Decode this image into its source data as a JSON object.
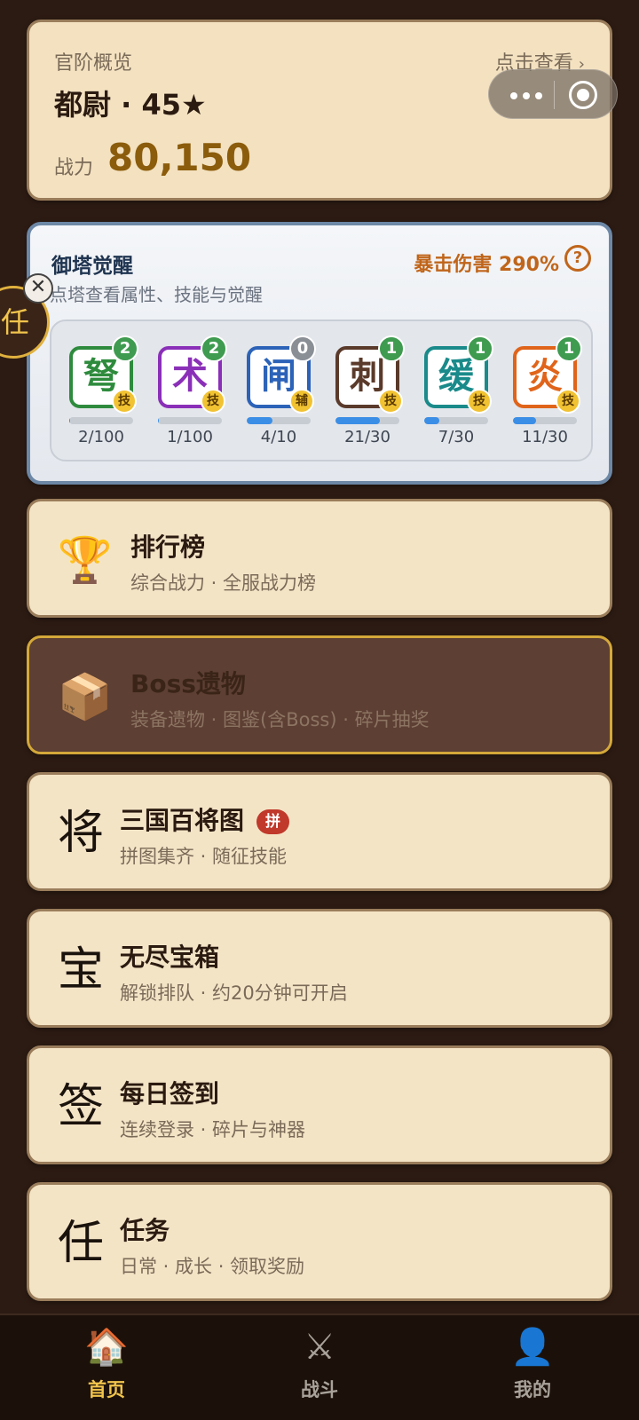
{
  "rank": {
    "label": "官阶概览",
    "link": "点击查看",
    "link_chevron": "›",
    "title": "都尉 · 45★",
    "power_label": "战力",
    "power_value": "80,150"
  },
  "tower": {
    "title": "御塔觉醒",
    "subtitle": "点塔查看属性、技能与觉醒",
    "crit": "暴击伤害 290%",
    "help": "?",
    "items": [
      {
        "char": "弩",
        "level": "2",
        "tag": "技",
        "progress": "2/100",
        "ratio": 0.02,
        "color": "#2e8b3d",
        "level_color": "#3e9b4f"
      },
      {
        "char": "术",
        "level": "2",
        "tag": "技",
        "progress": "1/100",
        "ratio": 0.01,
        "color": "#8a2fb8",
        "level_color": "#3e9b4f"
      },
      {
        "char": "闸",
        "level": "0",
        "tag": "辅",
        "progress": "4/10",
        "ratio": 0.4,
        "color": "#2c63b8",
        "level_color": "#8a8f96"
      },
      {
        "char": "刺",
        "level": "1",
        "tag": "技",
        "progress": "21/30",
        "ratio": 0.7,
        "color": "#5a3a2a",
        "level_color": "#3e9b4f"
      },
      {
        "char": "缓",
        "level": "1",
        "tag": "技",
        "progress": "7/30",
        "ratio": 0.233,
        "color": "#1a8a8a",
        "level_color": "#3e9b4f"
      },
      {
        "char": "炎",
        "level": "1",
        "tag": "技",
        "progress": "11/30",
        "ratio": 0.367,
        "color": "#e0641a",
        "level_color": "#3e9b4f"
      }
    ]
  },
  "task_bubble": {
    "char": "任",
    "close": "✕"
  },
  "menu": [
    {
      "name": "leaderboard",
      "icon": "🏆",
      "icon_name": "trophy-icon",
      "title": "排行榜",
      "subtitle": "综合战力 · 全服战力榜",
      "badge": "",
      "dark": false
    },
    {
      "name": "boss-relics",
      "icon": "📦",
      "icon_name": "package-icon",
      "title": "Boss遗物",
      "subtitle": "装备遗物 · 图鉴(含Boss) · 碎片抽奖",
      "badge": "",
      "dark": true
    },
    {
      "name": "generals-album",
      "glyph": "将",
      "title": "三国百将图",
      "subtitle": "拼图集齐 · 随征技能",
      "badge": "拼",
      "dark": false
    },
    {
      "name": "endless-chest",
      "glyph": "宝",
      "title": "无尽宝箱",
      "subtitle": "解锁排队 · 约20分钟可开启",
      "badge": "",
      "dark": false
    },
    {
      "name": "daily-signin",
      "glyph": "签",
      "title": "每日签到",
      "subtitle": "连续登录 · 碎片与神器",
      "badge": "",
      "dark": false
    },
    {
      "name": "tasks",
      "glyph": "任",
      "title": "任务",
      "subtitle": "日常 · 成长 · 领取奖励",
      "badge": "",
      "dark": false
    }
  ],
  "tabs": [
    {
      "name": "home",
      "icon": "🏠",
      "label": "首页",
      "color": "#f1c44c"
    },
    {
      "name": "battle",
      "icon": "⚔",
      "label": "战斗",
      "color": "#a8a29a"
    },
    {
      "name": "mine",
      "icon": "👤",
      "label": "我的",
      "color": "#a8a29a"
    }
  ],
  "colors": {
    "accent_gold": "#d4a83a",
    "power": "#8b5c0b",
    "progress": "#3b8ee6"
  }
}
